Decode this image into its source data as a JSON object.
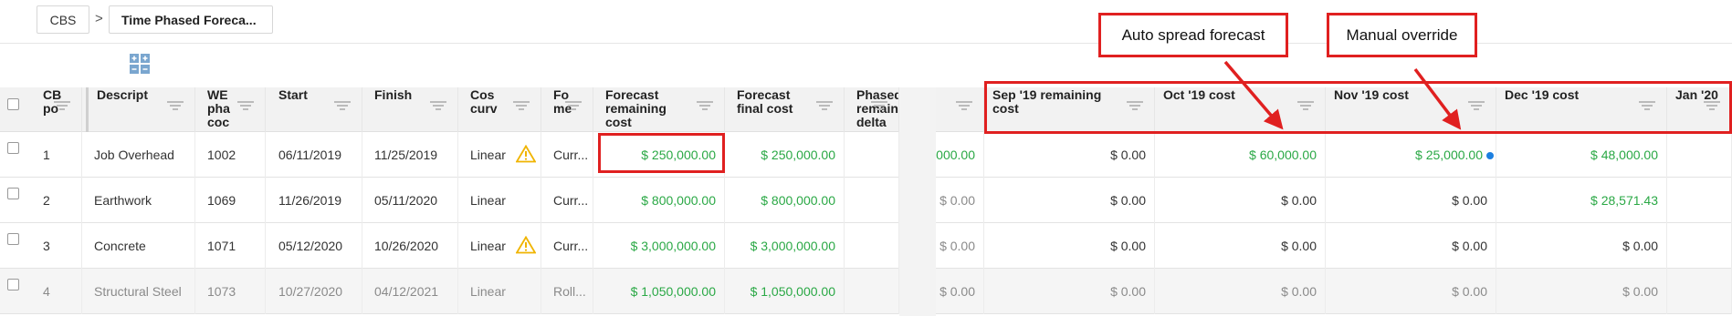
{
  "breadcrumb": {
    "root": "CBS",
    "separator": ">",
    "current": "Time Phased Foreca..."
  },
  "left_columns": [
    {
      "key": "cb",
      "lines": [
        "CB",
        "po"
      ]
    },
    {
      "key": "desc",
      "lines": [
        "Descript"
      ]
    },
    {
      "key": "wbs",
      "lines": [
        "WE",
        "pha",
        "coc"
      ]
    },
    {
      "key": "start",
      "lines": [
        "Start"
      ]
    },
    {
      "key": "finish",
      "lines": [
        "Finish"
      ]
    },
    {
      "key": "curve",
      "lines": [
        "Cos",
        "curv"
      ]
    },
    {
      "key": "fm",
      "lines": [
        "Fo",
        "me"
      ]
    },
    {
      "key": "frc",
      "lines": [
        "Forecast",
        "remaining",
        "cost"
      ]
    },
    {
      "key": "ffc",
      "lines": [
        "Forecast",
        "final cost"
      ]
    },
    {
      "key": "prd",
      "lines": [
        "Phased",
        "remain",
        "delta"
      ]
    }
  ],
  "right_columns": [
    {
      "key": "prev",
      "lines": [
        ""
      ]
    },
    {
      "key": "sep",
      "lines": [
        "Sep '19 remaining",
        "cost"
      ]
    },
    {
      "key": "oct",
      "lines": [
        "Oct '19 cost"
      ]
    },
    {
      "key": "nov",
      "lines": [
        "Nov '19 cost"
      ]
    },
    {
      "key": "dec",
      "lines": [
        "Dec '19 cost"
      ]
    },
    {
      "key": "jan",
      "lines": [
        "Jan '20"
      ]
    }
  ],
  "rows": [
    {
      "cb": "1",
      "desc": "Job Overhead",
      "wbs": "1002",
      "start": "06/11/2019",
      "finish": "11/25/2019",
      "curve": "Linear",
      "fm": "Curr...",
      "frc": "$ 250,000.00",
      "ffc": "$ 250,000.00",
      "prd": "",
      "prev": "000.00",
      "sep": "$ 0.00",
      "oct": "$ 60,000.00",
      "nov": "$ 25,000.00",
      "dec": "$ 48,000.00",
      "jan": ""
    },
    {
      "cb": "2",
      "desc": "Earthwork",
      "wbs": "1069",
      "start": "11/26/2019",
      "finish": "05/11/2020",
      "curve": "Linear",
      "fm": "Curr...",
      "frc": "$ 800,000.00",
      "ffc": "$ 800,000.00",
      "prd": "",
      "prev": "$ 0.00",
      "sep": "$ 0.00",
      "oct": "$ 0.00",
      "nov": "$ 0.00",
      "dec": "$ 28,571.43",
      "jan": ""
    },
    {
      "cb": "3",
      "desc": "Concrete",
      "wbs": "1071",
      "start": "05/12/2020",
      "finish": "10/26/2020",
      "curve": "Linear",
      "fm": "Curr...",
      "frc": "$ 3,000,000.00",
      "ffc": "$ 3,000,000.00",
      "prd": "",
      "prev": "$ 0.00",
      "sep": "$ 0.00",
      "oct": "$ 0.00",
      "nov": "$ 0.00",
      "dec": "$ 0.00",
      "jan": ""
    },
    {
      "cb": "4",
      "desc": "Structural Steel",
      "wbs": "1073",
      "start": "10/27/2020",
      "finish": "04/12/2021",
      "curve": "Linear",
      "fm": "Roll...",
      "frc": "$ 1,050,000.00",
      "ffc": "$ 1,050,000.00",
      "prd": "",
      "prev": "$ 0.00",
      "sep": "$ 0.00",
      "oct": "$ 0.00",
      "nov": "$ 0.00",
      "dec": "$ 0.00",
      "jan": ""
    }
  ],
  "annotations": {
    "auto_spread": "Auto spread forecast",
    "manual_override": "Manual override"
  },
  "colors": {
    "accent_red": "#e02020",
    "positive_green": "#2aa845",
    "override_dot": "#1c7fe0",
    "warning": "#f0b400"
  }
}
